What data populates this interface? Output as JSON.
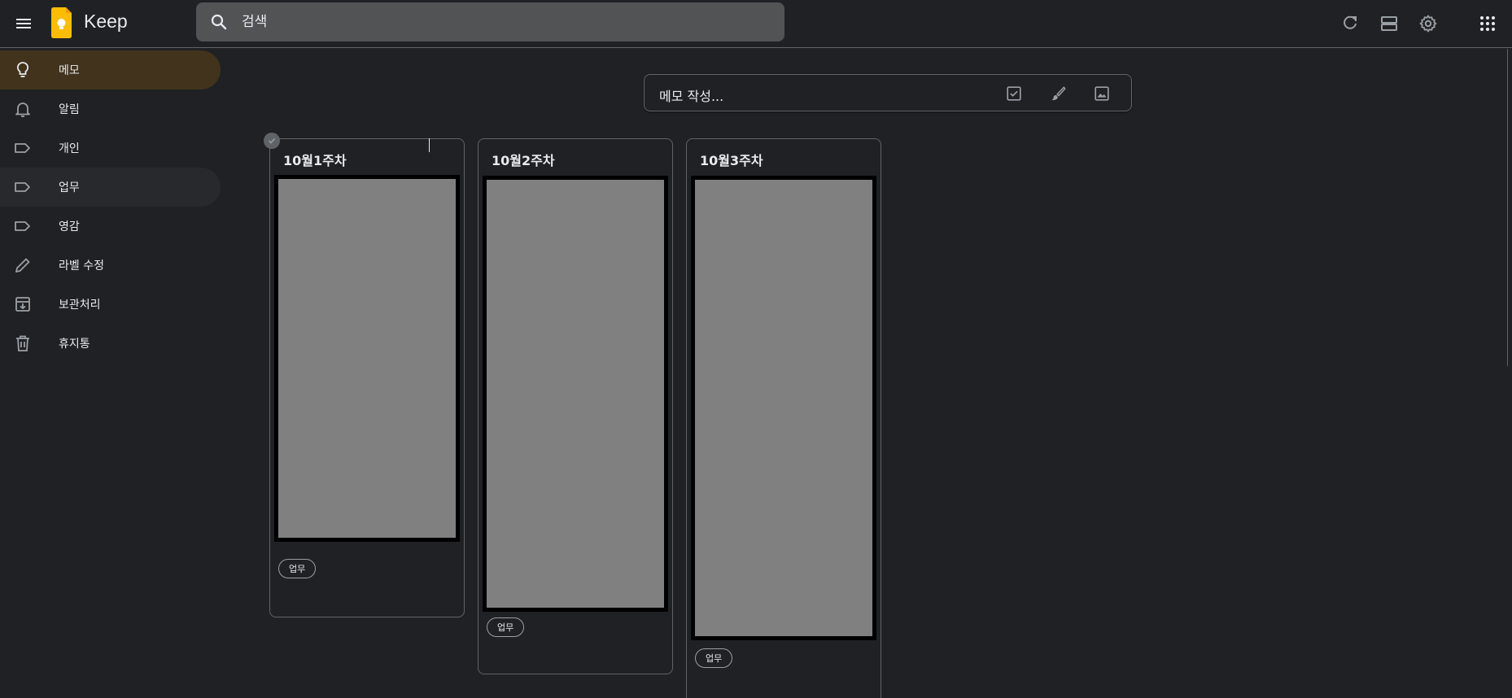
{
  "header": {
    "brand": "Keep",
    "search_placeholder": "검색"
  },
  "icons": {
    "menu": "hamburger-menu-icon",
    "logo": "keep-logo-icon",
    "search": "search-icon",
    "refresh": "refresh-icon",
    "list_view": "list-view-icon",
    "settings": "gear-icon",
    "apps": "apps-grid-icon"
  },
  "sidebar": {
    "items": [
      {
        "label": "메모",
        "icon": "lightbulb-icon"
      },
      {
        "label": "알림",
        "icon": "bell-icon"
      },
      {
        "label": "개인",
        "icon": "label-icon"
      },
      {
        "label": "업무",
        "icon": "label-icon"
      },
      {
        "label": "영감",
        "icon": "label-icon"
      },
      {
        "label": "라벨 수정",
        "icon": "pencil-icon"
      },
      {
        "label": "보관처리",
        "icon": "archive-icon"
      },
      {
        "label": "휴지통",
        "icon": "trash-icon"
      }
    ]
  },
  "composer": {
    "placeholder": "메모 작성...",
    "icons": [
      "checkbox-icon",
      "brush-icon",
      "image-icon"
    ]
  },
  "notes": [
    {
      "title": "10월1주차",
      "label": "업무"
    },
    {
      "title": "10월2주차",
      "label": "업무"
    },
    {
      "title": "10월3주차",
      "label": "업무"
    }
  ],
  "colors": {
    "background": "#202124",
    "active_nav": "#41331c",
    "search_bg": "#525355",
    "border": "#5f6368",
    "logo_yellow": "#fbbc04",
    "image_placeholder": "#808080"
  }
}
